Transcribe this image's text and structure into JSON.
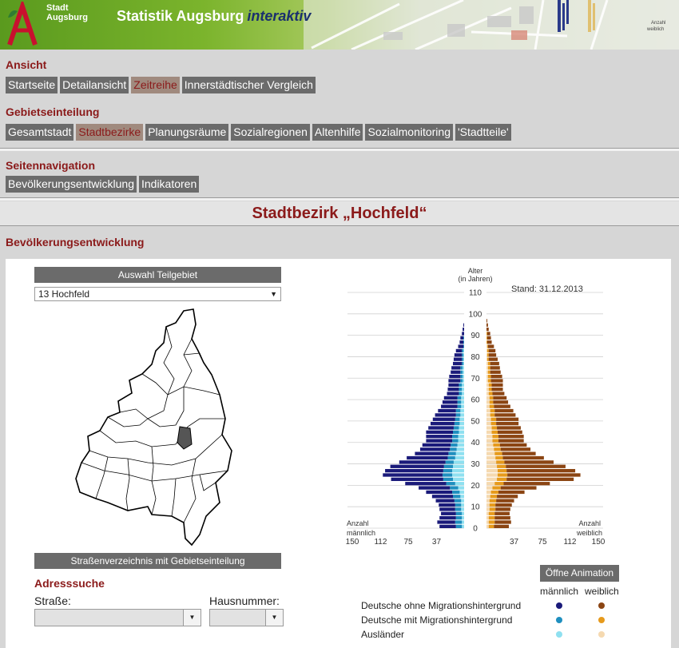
{
  "header": {
    "logo_line1": "Stadt",
    "logo_line2": "Augsburg",
    "title": "Statistik Augsburg",
    "title_accent": "interaktiv"
  },
  "ansicht": {
    "title": "Ansicht",
    "buttons": [
      "Startseite",
      "Detailansicht",
      "Zeitreihe",
      "Innerstädtischer Vergleich"
    ],
    "active": "Zeitreihe"
  },
  "gebiet": {
    "title": "Gebietseinteilung",
    "buttons": [
      "Gesamtstadt",
      "Stadtbezirke",
      "Planungsräume",
      "Sozialregionen",
      "Altenhilfe",
      "Sozialmonitoring",
      "'Stadtteile'"
    ],
    "active": "Stadtbezirke"
  },
  "seiten": {
    "title": "Seitennavigation",
    "buttons": [
      "Bevölkerungsentwicklung",
      "Indikatoren"
    ]
  },
  "district_title": "Stadtbezirk „Hochfeld“",
  "section_title": "Bevölkerungsentwicklung",
  "teilgebiet": {
    "header": "Auswahl Teilgebiet",
    "selected": "13 Hochfeld"
  },
  "strassen_button": "Straßenverzeichnis mit Gebietseinteilung",
  "adresse": {
    "title": "Adresssuche",
    "strasse_label": "Straße:",
    "hausnummer_label": "Hausnummer:",
    "strasse_value": "",
    "hausnummer_value": ""
  },
  "animation_button": "Öffne Animation",
  "legend": {
    "male_header": "männlich",
    "female_header": "weiblich",
    "items": [
      {
        "label": "Deutsche ohne Migrationshintergrund",
        "male_color": "#1a1a7a",
        "female_color": "#8b4513"
      },
      {
        "label": "Deutsche mit Migrationshintergrund",
        "male_color": "#1f8fbf",
        "female_color": "#e69a1c"
      },
      {
        "label": "Ausländer",
        "male_color": "#8fe0f0",
        "female_color": "#f5d9b0"
      }
    ]
  },
  "chart_data": {
    "type": "bar",
    "title": "",
    "stand": "Stand: 31.12.2013",
    "ylabel_line1": "Alter",
    "ylabel_line2": "(in Jahren)",
    "left_label": "Anzahl",
    "left_sub": "männlich",
    "right_label": "Anzahl",
    "right_sub": "weiblich",
    "age_ticks": [
      0,
      10,
      20,
      30,
      40,
      50,
      60,
      70,
      80,
      90,
      100,
      110
    ],
    "x_ticks_left": [
      "150",
      "112",
      "75",
      "37"
    ],
    "x_ticks_right": [
      "37",
      "75",
      "112",
      "150"
    ],
    "xlim": [
      0,
      150
    ],
    "ylim": [
      0,
      110
    ],
    "ages": [
      0,
      2,
      4,
      6,
      8,
      10,
      12,
      14,
      16,
      18,
      20,
      22,
      24,
      26,
      28,
      30,
      32,
      34,
      36,
      38,
      40,
      42,
      44,
      46,
      48,
      50,
      52,
      54,
      56,
      58,
      60,
      62,
      64,
      66,
      68,
      70,
      72,
      74,
      76,
      78,
      80,
      82,
      84,
      86,
      88,
      90,
      92,
      94,
      96
    ],
    "series": [
      {
        "name": "Deutsche ohne Migrationshintergrund",
        "side": "male",
        "color": "#1a1a7a",
        "values": [
          22,
          24,
          22,
          20,
          21,
          22,
          25,
          28,
          35,
          42,
          55,
          70,
          80,
          78,
          72,
          62,
          55,
          45,
          40,
          38,
          35,
          35,
          36,
          34,
          32,
          30,
          28,
          24,
          22,
          20,
          18,
          16,
          15,
          14,
          16,
          15,
          13,
          12,
          12,
          11,
          10,
          8,
          7,
          5,
          4,
          3,
          2,
          1,
          0
        ]
      },
      {
        "name": "Deutsche mit Migrationshintergrund",
        "side": "male",
        "color": "#1f8fbf",
        "values": [
          8,
          9,
          8,
          8,
          8,
          8,
          9,
          10,
          10,
          11,
          12,
          13,
          13,
          12,
          12,
          11,
          10,
          10,
          9,
          9,
          8,
          8,
          8,
          7,
          7,
          6,
          6,
          6,
          5,
          5,
          5,
          4,
          4,
          4,
          3,
          3,
          3,
          3,
          2,
          2,
          2,
          2,
          1,
          1,
          1,
          0,
          0,
          0,
          0
        ]
      },
      {
        "name": "Ausländer",
        "side": "male",
        "color": "#8fe0f0",
        "values": [
          3,
          3,
          3,
          3,
          4,
          4,
          4,
          5,
          6,
          8,
          12,
          15,
          16,
          16,
          15,
          14,
          12,
          11,
          10,
          9,
          8,
          8,
          7,
          7,
          6,
          6,
          5,
          5,
          4,
          4,
          4,
          3,
          3,
          3,
          2,
          2,
          2,
          2,
          1,
          1,
          1,
          1,
          0,
          0,
          0,
          0,
          0,
          0,
          0
        ]
      },
      {
        "name": "Deutsche ohne Migrationshintergrund",
        "side": "female",
        "color": "#8b4513",
        "values": [
          20,
          22,
          21,
          20,
          20,
          22,
          24,
          28,
          35,
          48,
          62,
          90,
          98,
          92,
          80,
          66,
          55,
          45,
          40,
          36,
          34,
          34,
          33,
          32,
          30,
          30,
          28,
          25,
          22,
          20,
          18,
          16,
          15,
          15,
          16,
          15,
          14,
          13,
          12,
          12,
          10,
          9,
          8,
          6,
          5,
          4,
          3,
          2,
          1
        ]
      },
      {
        "name": "Deutsche mit Migrationshintergrund",
        "side": "female",
        "color": "#e69a1c",
        "values": [
          7,
          8,
          8,
          8,
          8,
          8,
          9,
          9,
          10,
          11,
          12,
          13,
          13,
          12,
          12,
          11,
          10,
          10,
          9,
          9,
          8,
          8,
          8,
          7,
          7,
          7,
          6,
          6,
          6,
          5,
          5,
          5,
          4,
          4,
          4,
          4,
          3,
          3,
          3,
          2,
          2,
          2,
          1,
          1,
          1,
          1,
          0,
          0,
          0
        ]
      },
      {
        "name": "Ausländer",
        "side": "female",
        "color": "#f5d9b0",
        "values": [
          3,
          3,
          3,
          3,
          4,
          4,
          4,
          5,
          6,
          8,
          11,
          14,
          15,
          15,
          14,
          13,
          12,
          11,
          10,
          9,
          8,
          8,
          7,
          7,
          6,
          6,
          5,
          5,
          4,
          4,
          4,
          3,
          3,
          3,
          2,
          2,
          2,
          2,
          2,
          1,
          1,
          1,
          1,
          0,
          0,
          0,
          0,
          0,
          0
        ]
      }
    ]
  }
}
